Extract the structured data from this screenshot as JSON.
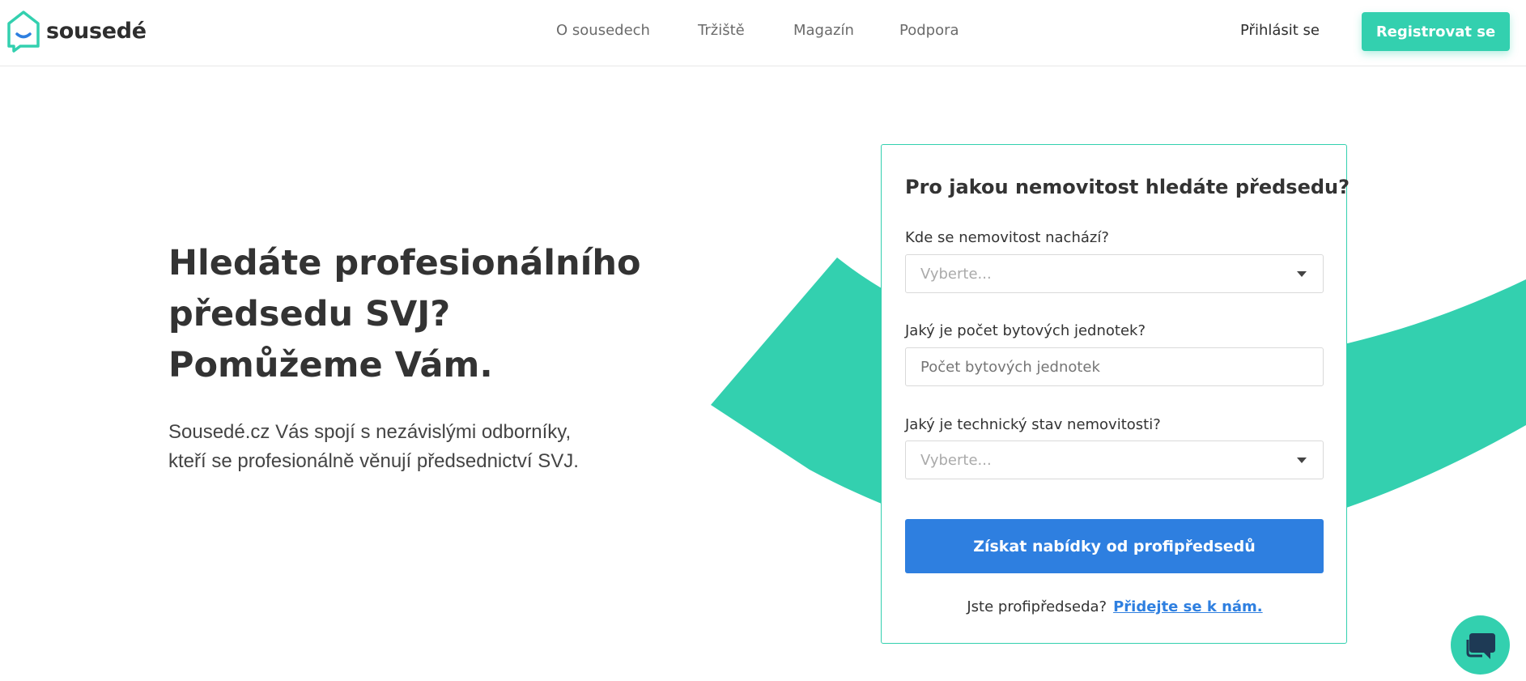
{
  "header": {
    "logo_text": "sousedé",
    "nav": [
      {
        "label": "O sousedech"
      },
      {
        "label": "Tržiště"
      },
      {
        "label": "Magazín"
      },
      {
        "label": "Podpora"
      }
    ],
    "login_label": "Přihlásit se",
    "register_label": "Registrovat se"
  },
  "hero": {
    "title_line1": "Hledáte profesionálního",
    "title_line2": "předsedu SVJ?",
    "title_line3": "Pomůžeme Vám.",
    "desc_line1": "Sousedé.cz Vás spojí s nezávislými odborníky,",
    "desc_line2": "kteří se profesionálně věnují předsednictví SVJ."
  },
  "form": {
    "title": "Pro jakou nemovitost hledáte předsedu?",
    "location_label": "Kde se nemovitost nachází?",
    "location_placeholder": "Vyberte...",
    "units_label": "Jaký je počet bytových jednotek?",
    "units_placeholder": "Počet bytových jednotek",
    "condition_label": "Jaký je technický stav nemovitosti?",
    "condition_placeholder": "Vyberte...",
    "submit_label": "Získat nabídky od profipředsedů",
    "footer_text": "Jste profipředseda?",
    "footer_link": "Přidejte se k nám."
  },
  "colors": {
    "accent": "#33d0af",
    "primary_button": "#2e7fe0",
    "text": "#333333"
  },
  "icons": {
    "logo": "house-speech-bubble-icon",
    "dropdown": "caret-down-icon",
    "chat": "chat-bubble-icon"
  }
}
